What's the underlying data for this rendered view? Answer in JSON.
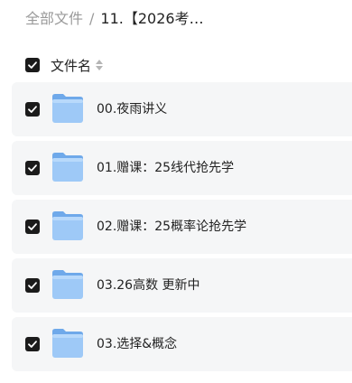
{
  "breadcrumb": {
    "root": "全部文件",
    "separator": "/",
    "current": "11.【2026考…"
  },
  "header": {
    "select_all_checked": true,
    "column_label": "文件名"
  },
  "files": [
    {
      "name": "00.夜雨讲义",
      "checked": true,
      "icon": "folder-icon"
    },
    {
      "name": "01.赠课：25线代抢先学",
      "checked": true,
      "icon": "folder-icon"
    },
    {
      "name": "02.赠课：25概率论抢先学",
      "checked": true,
      "icon": "folder-icon"
    },
    {
      "name": "03.26高数 更新中",
      "checked": true,
      "icon": "folder-icon"
    },
    {
      "name": "03.选择&概念",
      "checked": true,
      "icon": "folder-icon"
    }
  ],
  "colors": {
    "checkbox": "#1b1b1b",
    "row_background": "#f5f6f7",
    "folder_front": "#9ec9f7",
    "folder_back": "#6fa9ea"
  }
}
